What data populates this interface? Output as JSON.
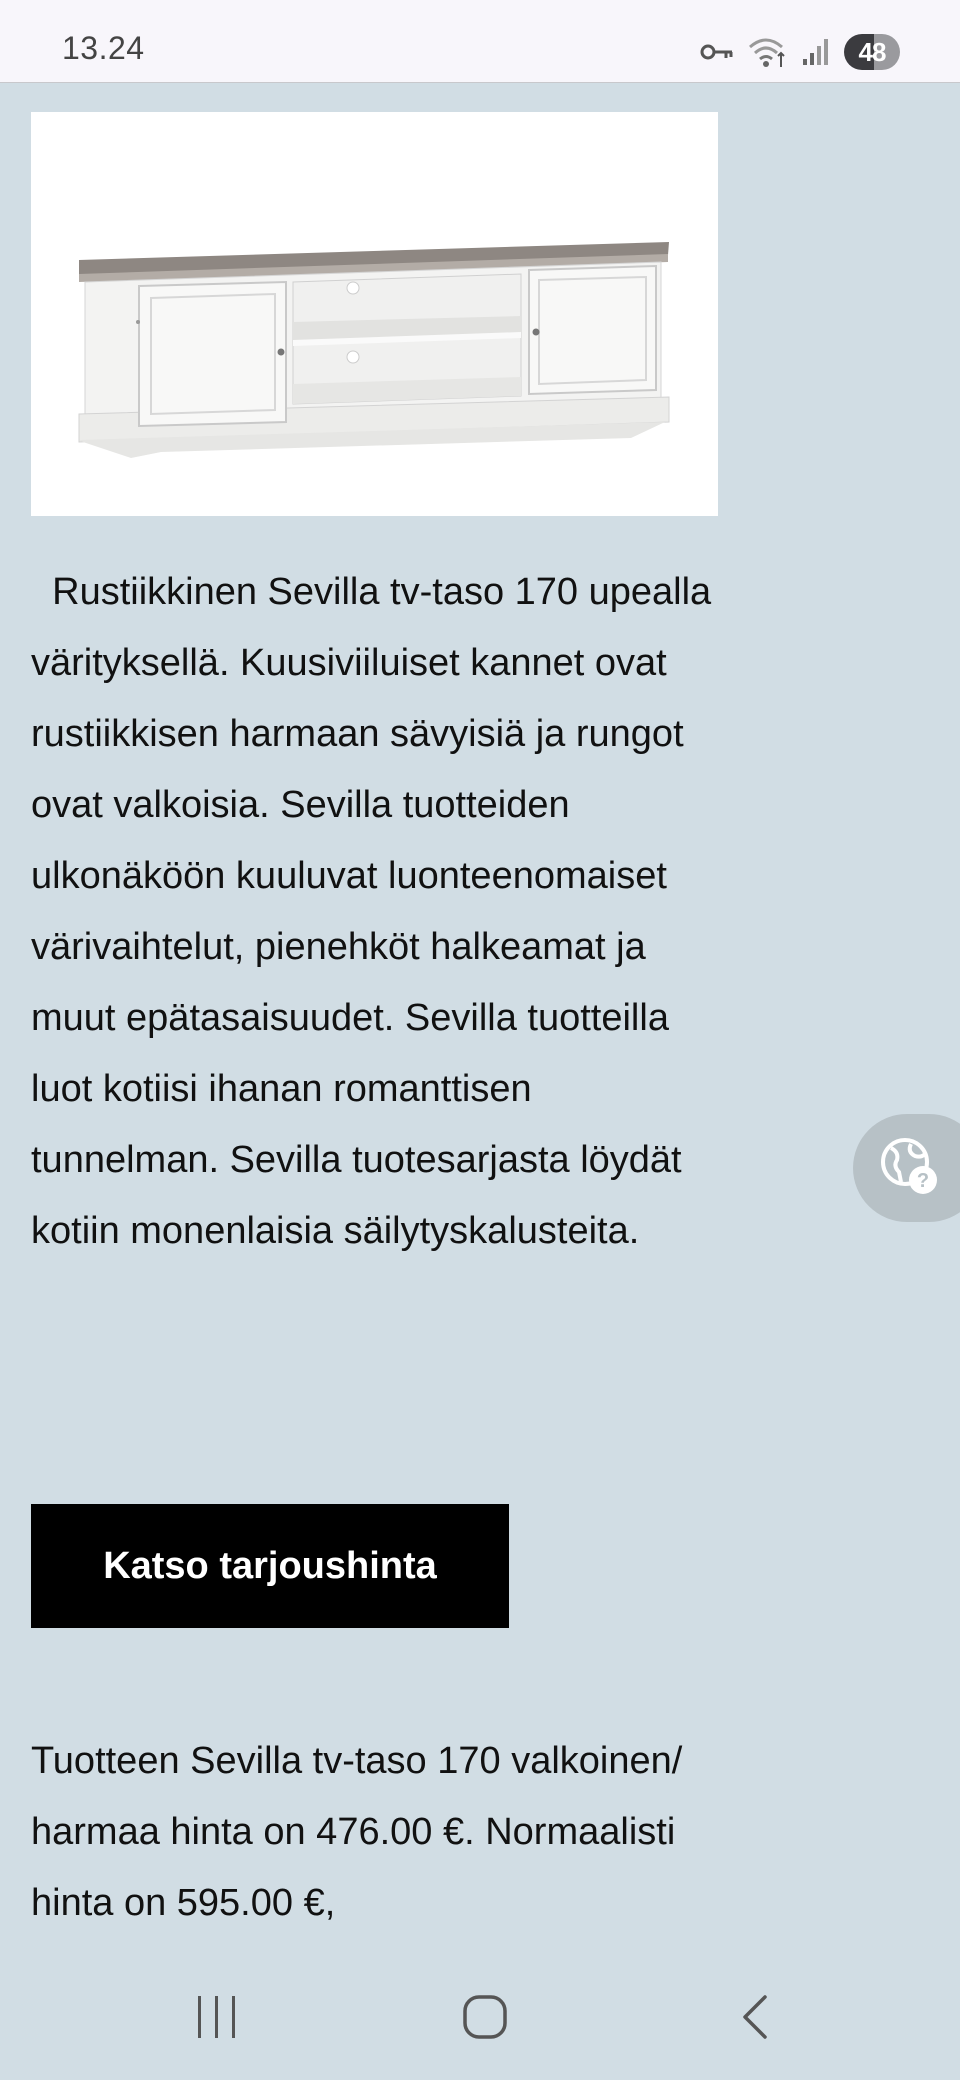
{
  "status_bar": {
    "time": "13.24",
    "battery": "48"
  },
  "product": {
    "image_alt": "Sevilla tv-taso 170 valkoinen/harmaa",
    "description": "  Rustiikkinen Sevilla tv-taso 170 upealla värityksellä. Kuusiviiluiset kannet ovat rustiikkisen harmaan sävyisiä ja rungot ovat valkoisia. Sevilla tuotteiden ulkonäköön kuuluvat luonteenomaiset värivaihtelut, pienehköt halkeamat ja muut epätasaisuudet. Sevilla tuotteilla luot kotiisi ihanan romanttisen tunnelman. Sevilla tuotesarjasta löydät kotiin monenlaisia säilytyskalusteita.",
    "cta_label": "Katso tarjoushinta",
    "price_text": "Tuotteen Sevilla tv-taso 170 valkoinen/ harmaa hinta on 476.00 €. Normaalisti hinta on 595.00 €,"
  },
  "floating_button": {
    "icon": "translate-globe-icon"
  },
  "nav_bar": {
    "recents_icon": "recent-apps-icon",
    "home_icon": "home-icon",
    "back_icon": "back-icon"
  },
  "colors": {
    "page_background": "#d1dde4",
    "button_background": "#000000",
    "button_text": "#ffffff"
  }
}
